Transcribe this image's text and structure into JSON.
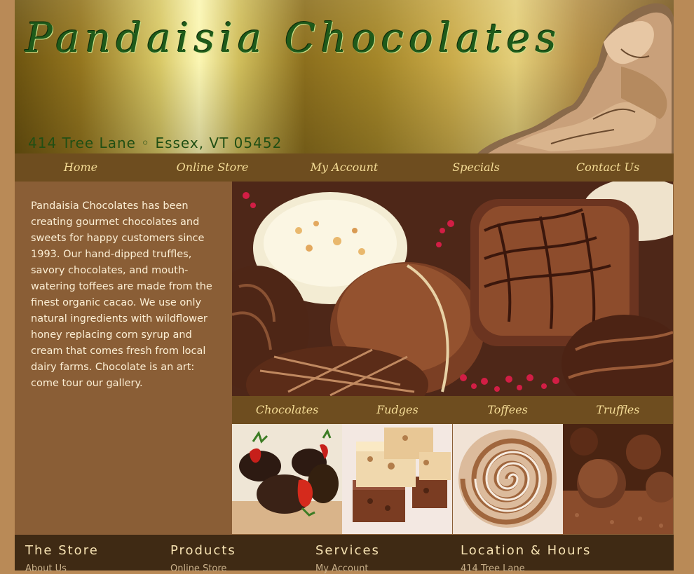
{
  "header": {
    "logo": "Pandaisia Chocolates",
    "address": "414 Tree Lane ◦ Essex, VT 05452"
  },
  "nav": [
    "Home",
    "Online Store",
    "My Account",
    "Specials",
    "Contact Us"
  ],
  "intro": "Pandaisia Chocolates has been creating gourmet chocolates and sweets for happy customers since 1993. Our hand-dipped truffles, savory chocolates, and mouth-watering toffees are made from the finest organic cacao. We use only natural ingredients with wildflower honey replacing corn syrup and cream that comes fresh from local dairy farms. Chocolate is an art: come tour our gallery.",
  "subnav": [
    "Chocolates",
    "Fudges",
    "Toffees",
    "Truffles"
  ],
  "footer": {
    "columns": [
      {
        "title": "The Store",
        "first_link": "About Us"
      },
      {
        "title": "Products",
        "first_link": "Online Store"
      },
      {
        "title": "Services",
        "first_link": "My Account"
      },
      {
        "title": "Location & Hours",
        "first_link": "414 Tree Lane"
      }
    ]
  }
}
